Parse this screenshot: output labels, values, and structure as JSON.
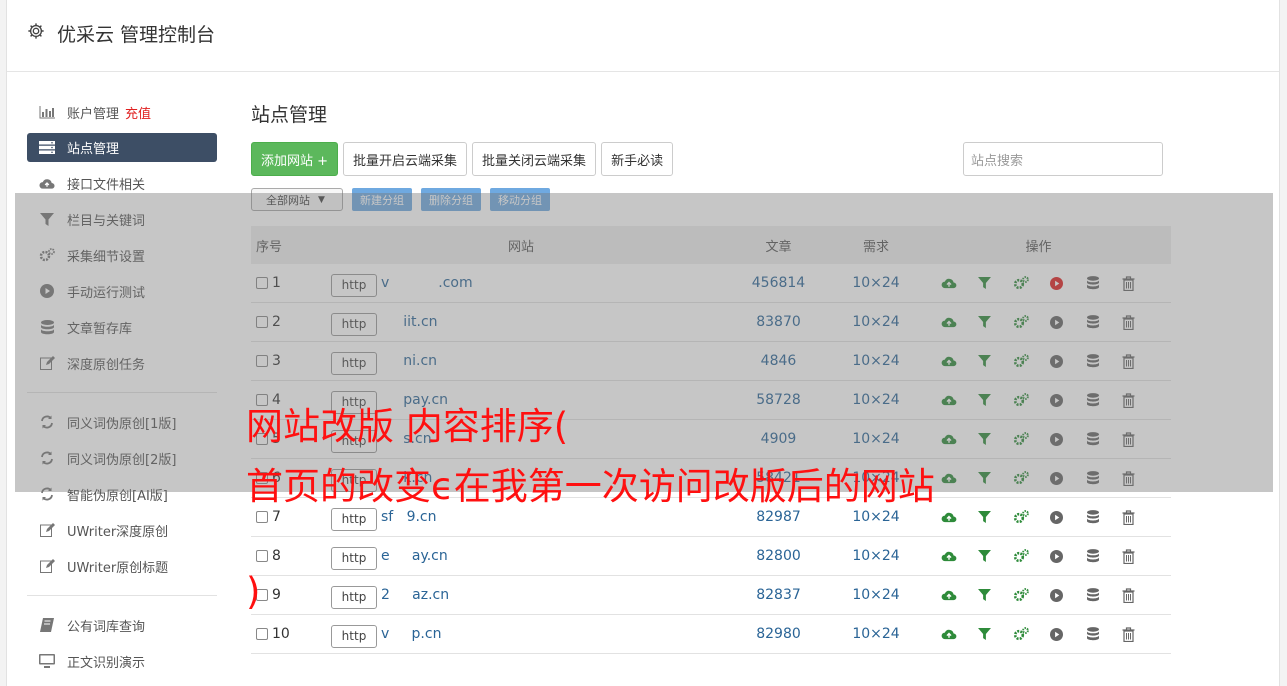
{
  "app": {
    "title": "优采云 管理控制台"
  },
  "sidebar": {
    "group1": [
      {
        "label": "账户管理",
        "badge": "充值",
        "icon": "bar-chart-icon"
      },
      {
        "label": "站点管理",
        "icon": "server-icon",
        "active": true
      },
      {
        "label": "接口文件相关",
        "icon": "cloud-upload-icon"
      },
      {
        "label": "栏目与关键词",
        "icon": "filter-icon"
      },
      {
        "label": "采集细节设置",
        "icon": "gears-icon"
      },
      {
        "label": "手动运行测试",
        "icon": "play-circle-icon"
      },
      {
        "label": "文章暂存库",
        "icon": "database-icon"
      },
      {
        "label": "深度原创任务",
        "icon": "edit-icon"
      }
    ],
    "group2": [
      {
        "label": "同义词伪原创[1版]",
        "icon": "refresh-icon"
      },
      {
        "label": "同义词伪原创[2版]",
        "icon": "refresh-icon"
      },
      {
        "label": "智能伪原创[AI版]",
        "icon": "refresh-icon"
      },
      {
        "label": "UWriter深度原创",
        "icon": "edit-icon"
      },
      {
        "label": "UWriter原创标题",
        "icon": "edit-icon"
      }
    ],
    "group3": [
      {
        "label": "公有词库查询",
        "icon": "book-icon"
      },
      {
        "label": "正文识别演示",
        "icon": "monitor-icon"
      }
    ]
  },
  "main": {
    "title": "站点管理",
    "buttons": {
      "add": "添加网站 +",
      "batch_on": "批量开启云端采集",
      "batch_off": "批量关闭云端采集",
      "guide": "新手必读"
    },
    "search_placeholder": "站点搜索",
    "group_select": "全部网站",
    "group_buttons": {
      "new": "新建分组",
      "delete": "删除分组",
      "move": "移动分组"
    },
    "table": {
      "headers": {
        "no": "序号",
        "site": "网站",
        "articles": "文章",
        "demand": "需求",
        "ops": "操作"
      },
      "rows": [
        {
          "no": "1",
          "proto": "http",
          "domain": "v           .com",
          "articles": "456814",
          "demand": "10×24",
          "running": true
        },
        {
          "no": "2",
          "proto": "http",
          "domain": "     iit.cn",
          "articles": "83870",
          "demand": "10×24"
        },
        {
          "no": "3",
          "proto": "http",
          "domain": "     ni.cn",
          "articles": "4846",
          "demand": "10×24"
        },
        {
          "no": "4",
          "proto": "http",
          "domain": "     pay.cn",
          "articles": "58728",
          "demand": "10×24"
        },
        {
          "no": "5",
          "proto": "http",
          "domain": "     s.cn",
          "articles": "4909",
          "demand": "10×24"
        },
        {
          "no": "6",
          "proto": "http",
          "domain": "     k.cn",
          "articles": "58421",
          "demand": "10×24"
        },
        {
          "no": "7",
          "proto": "http",
          "domain": "sf   9.cn",
          "articles": "82987",
          "demand": "10×24"
        },
        {
          "no": "8",
          "proto": "http",
          "domain": "e     ay.cn",
          "articles": "82800",
          "demand": "10×24"
        },
        {
          "no": "9",
          "proto": "http",
          "domain": "2     az.cn",
          "articles": "82837",
          "demand": "10×24"
        },
        {
          "no": "10",
          "proto": "http",
          "domain": "v     p.cn",
          "articles": "82980",
          "demand": "10×24"
        }
      ]
    }
  },
  "watermark": {
    "line1": "网站改版 内容排序(",
    "line2": "首页的改变ϵ在我第一次访问改版后的网站",
    "line3": ")"
  },
  "colors": {
    "green": "#5cb85c",
    "nav_active": "#3d4e65",
    "link": "#2a6496",
    "watermark": "#ff1010",
    "run": "#e02020"
  }
}
